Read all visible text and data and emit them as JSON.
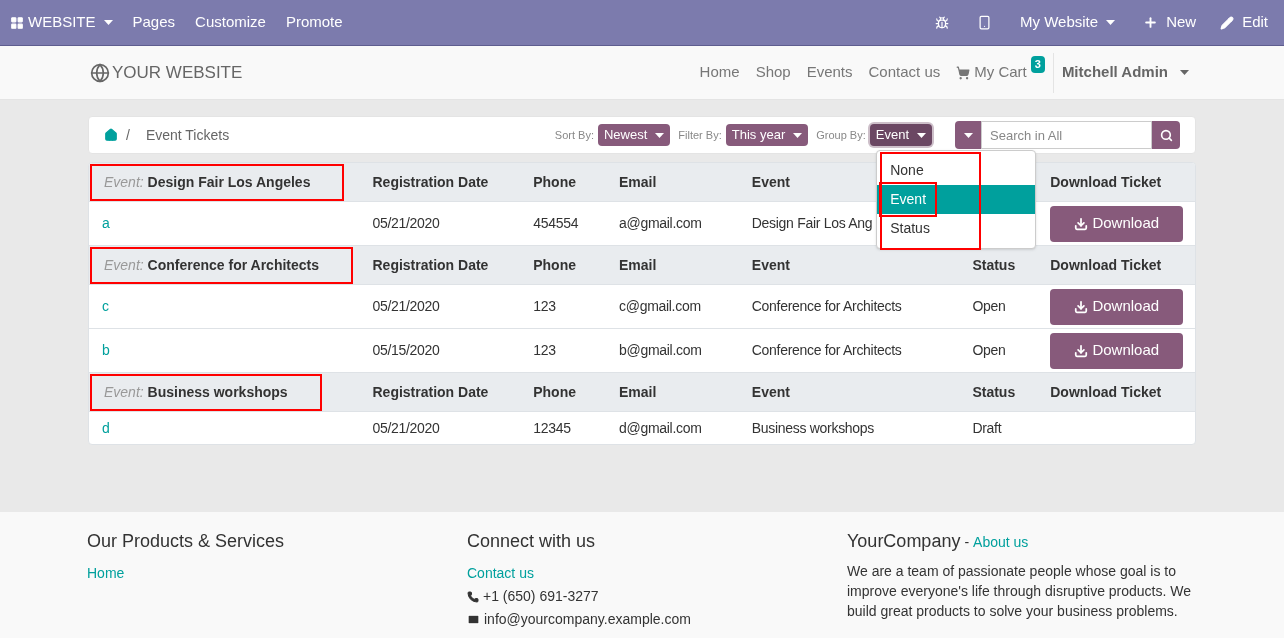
{
  "top_bar": {
    "app_menu": "WEBSITE",
    "items": [
      "Pages",
      "Customize",
      "Promote"
    ],
    "website_menu": "My Website",
    "new_label": "New",
    "edit_label": "Edit"
  },
  "header": {
    "logo": "YOUR WEBSITE",
    "nav": [
      "Home",
      "Shop",
      "Events",
      "Contact us"
    ],
    "cart": {
      "label": "My Cart",
      "count": "3"
    },
    "user": "Mitchell Admin"
  },
  "toolbar": {
    "breadcrumb_separator": "/",
    "breadcrumb": "Event Tickets",
    "filters": [
      {
        "label": "Sort By:",
        "value": "Newest",
        "open": false
      },
      {
        "label": "Filter By:",
        "value": "This year",
        "open": false
      },
      {
        "label": "Group By:",
        "value": "Event",
        "open": true
      }
    ],
    "search": {
      "placeholder": "Search in All"
    },
    "group_by_menu": {
      "highlighted": true,
      "options": [
        {
          "label": "None",
          "selected": false,
          "highlighted": false
        },
        {
          "label": "Event",
          "selected": true,
          "highlighted": true
        },
        {
          "label": "Status",
          "selected": false,
          "highlighted": false
        }
      ]
    }
  },
  "groups": [
    {
      "label": "Event:",
      "name": "Design Fair Los Angeles",
      "highlighted": true,
      "header": {
        "registration_date": "Registration Date",
        "phone": "Phone",
        "email": "Email",
        "event": "Event",
        "download_ticket": "Download Ticket"
      },
      "rows": [
        {
          "name": "a",
          "registration_date": "05/21/2020",
          "phone": "454554",
          "email": "a@gmail.com",
          "event": "Design Fair Los Ang",
          "download": "Download"
        }
      ]
    },
    {
      "label": "Event:",
      "name": "Conference for Architects",
      "highlighted": true,
      "header": {
        "registration_date": "Registration Date",
        "phone": "Phone",
        "email": "Email",
        "event": "Event",
        "status": "Status",
        "download_ticket": "Download Ticket"
      },
      "rows": [
        {
          "name": "c",
          "registration_date": "05/21/2020",
          "phone": "123",
          "email": "c@gmail.com",
          "event": "Conference for Architects",
          "status": "Open",
          "download": "Download"
        },
        {
          "name": "b",
          "registration_date": "05/15/2020",
          "phone": "123",
          "email": "b@gmail.com",
          "event": "Conference for Architects",
          "status": "Open",
          "download": "Download"
        }
      ]
    },
    {
      "label": "Event:",
      "name": "Business workshops",
      "highlighted": true,
      "header": {
        "registration_date": "Registration Date",
        "phone": "Phone",
        "email": "Email",
        "event": "Event",
        "status": "Status",
        "download_ticket": "Download Ticket"
      },
      "rows": [
        {
          "name": "d",
          "registration_date": "05/21/2020",
          "phone": "12345",
          "email": "d@gmail.com",
          "event": "Business workshops",
          "status": "Draft"
        }
      ]
    }
  ],
  "footer": {
    "products": {
      "title": "Our Products & Services",
      "links": [
        "Home"
      ]
    },
    "connect": {
      "title": "Connect with us",
      "link": "Contact us",
      "phone": "+1 (650) 691-3277",
      "email": "info@yourcompany.example.com"
    },
    "company": {
      "title": "YourCompany",
      "separator": "-",
      "link": "About us",
      "text": "We are a team of passionate people whose goal is to improve everyone's life through disruptive products. We build great products to solve your business problems."
    }
  }
}
